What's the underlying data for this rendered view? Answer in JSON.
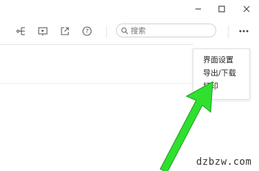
{
  "window_controls": [
    "minimize",
    "maximize",
    "close"
  ],
  "toolbar": {
    "icons": [
      "share-tree-icon",
      "play-icon",
      "external-link-icon",
      "help-icon"
    ],
    "search": {
      "placeholder": "搜索"
    },
    "more": "more-icon"
  },
  "menu": {
    "items": [
      {
        "label": "界面设置"
      },
      {
        "label": "导出/下载"
      },
      {
        "label": "打印"
      }
    ]
  },
  "watermark": "dzbzw.com",
  "colors": {
    "arrow": "#2fe02f",
    "arrow_outline": "#1a9a1a"
  }
}
